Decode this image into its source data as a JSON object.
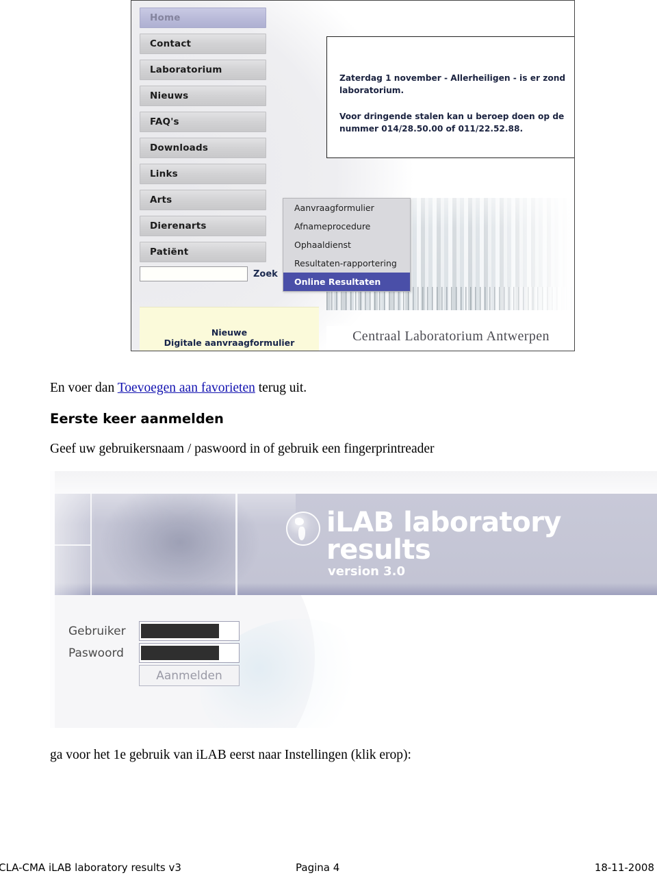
{
  "screenshot_website": {
    "nav_items": [
      {
        "label": "Home",
        "active": true
      },
      {
        "label": "Contact",
        "active": false
      },
      {
        "label": "Laboratorium",
        "active": false
      },
      {
        "label": "Nieuws",
        "active": false
      },
      {
        "label": "FAQ's",
        "active": false
      },
      {
        "label": "Downloads",
        "active": false
      },
      {
        "label": "Links",
        "active": false
      },
      {
        "label": "Arts",
        "active": false
      },
      {
        "label": "Dierenarts",
        "active": false
      },
      {
        "label": "Patiënt",
        "active": false
      }
    ],
    "search": {
      "value": "",
      "placeholder": "",
      "button_label": "Zoek"
    },
    "promo": {
      "line1": "Nieuwe",
      "line2": "Digitale aanvraagformulier"
    },
    "notice": {
      "paragraph1": "Zaterdag 1 november - Allerheiligen - is er zond",
      "paragraph1_line2": "laboratorium.",
      "paragraph2": "Voor dringende stalen kan u beroep doen op de",
      "paragraph2_line2": "nummer 014/28.50.00 of 011/22.52.88."
    },
    "dropdown": {
      "items": [
        {
          "label": "Aanvraagformulier",
          "selected": false
        },
        {
          "label": "Afnameprocedure",
          "selected": false
        },
        {
          "label": "Ophaaldienst",
          "selected": false
        },
        {
          "label": "Resultaten-rapportering",
          "selected": false
        },
        {
          "label": "Online Resultaten",
          "selected": true
        }
      ]
    },
    "building_caption": "Centraal Laboratorium Antwerpen"
  },
  "document_text": {
    "line1_before": "En voer dan ",
    "line1_link": "Toevoegen aan favorieten",
    "line1_after": " terug uit.",
    "heading": "Eerste keer aanmelden",
    "line2": "Geef uw gebruikersnaam / paswoord in of gebruik een fingerprintreader",
    "line3": "ga voor het 1e gebruik van iLAB eerst naar Instellingen (klik erop):"
  },
  "screenshot_login": {
    "logo_main": "iLAB laboratory results",
    "logo_sub": "version 3.0",
    "form": {
      "user_label": "Gebruiker",
      "user_value": "",
      "password_label": "Paswoord",
      "password_value": "",
      "submit_label": "Aanmelden"
    }
  },
  "footer": {
    "left": "CLA-CMA iLAB laboratory results v3",
    "center": "Pagina 4",
    "right": "18-11-2008"
  },
  "colors": {
    "link": "#1212b0",
    "nav_active_bg": "#b9bad9",
    "dropdown_selected_bg": "#4a4fa8",
    "promo_bg": "#fbfada",
    "banner_bg": "#c3c4d4",
    "notice_text": "#1b2340"
  }
}
